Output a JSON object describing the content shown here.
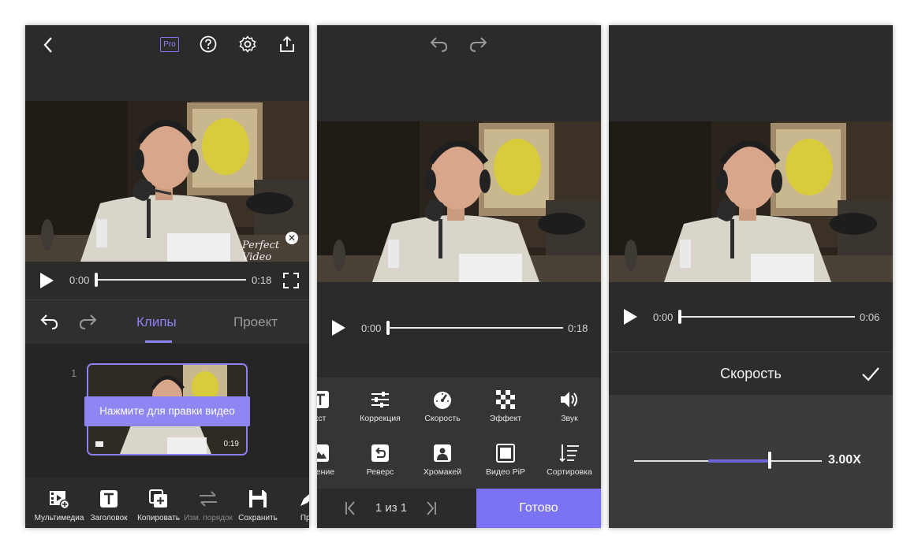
{
  "colors": {
    "accent": "#8c82f5",
    "done": "#7b73f3",
    "bg": "#2b2b2b"
  },
  "panel1": {
    "header_icons": [
      "back-icon",
      "pro-badge",
      "help-icon",
      "settings-icon",
      "share-icon"
    ],
    "pro_label": "Pro",
    "watermark": "Perfect Video",
    "player": {
      "current_time": "0:00",
      "end_time": "0:18"
    },
    "tabs": [
      {
        "label": "Клипы",
        "active": true
      },
      {
        "label": "Проект",
        "active": false
      }
    ],
    "clip": {
      "index": "1",
      "duration": "0:19",
      "tooltip": "Нажмите для правки видео"
    },
    "toolbar": [
      {
        "label": "Мультимедиа",
        "icon": "media-add-icon"
      },
      {
        "label": "Заголовок",
        "icon": "title-icon"
      },
      {
        "label": "Копировать",
        "icon": "copy-icon"
      },
      {
        "label": "Изм. порядок",
        "icon": "reorder-icon",
        "disabled": true
      },
      {
        "label": "Сохранить",
        "icon": "save-icon"
      },
      {
        "label": "Пра",
        "icon": "pen-icon"
      }
    ]
  },
  "panel2": {
    "player": {
      "current_time": "0:00",
      "end_time": "0:18"
    },
    "tools_row1": [
      {
        "label": "кст",
        "icon": "text-icon"
      },
      {
        "label": "Коррекция",
        "icon": "sliders-icon"
      },
      {
        "label": "Скорость",
        "icon": "speedometer-icon"
      },
      {
        "label": "Эффект",
        "icon": "checker-icon"
      },
      {
        "label": "Звук",
        "icon": "speaker-icon"
      }
    ],
    "tools_row2": [
      {
        "label": "ажение",
        "icon": "image-icon"
      },
      {
        "label": "Реверс",
        "icon": "reverse-icon"
      },
      {
        "label": "Хромакей",
        "icon": "chroma-icon"
      },
      {
        "label": "Видео PiP",
        "icon": "pip-icon"
      },
      {
        "label": "Сортировка",
        "icon": "sort-icon"
      }
    ],
    "pager": "1 из 1",
    "done_label": "Готово"
  },
  "panel3": {
    "player": {
      "current_time": "0:00",
      "end_time": "0:06"
    },
    "speed_title": "Скорость",
    "speed_value": "3.00X"
  }
}
